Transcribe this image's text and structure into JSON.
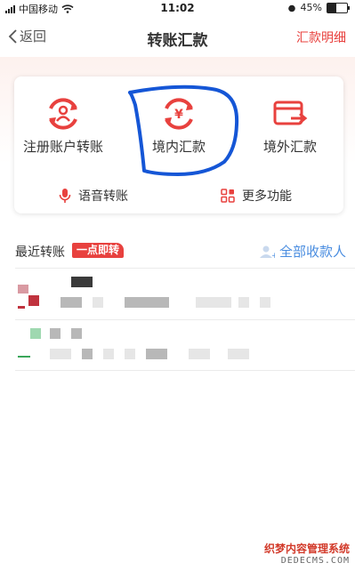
{
  "status_bar": {
    "carrier": "中国移动",
    "time": "11:02",
    "battery": "45%",
    "battery_level": 0.45
  },
  "nav": {
    "back_label": "返回",
    "title": "转账汇款",
    "right_link": "汇款明细"
  },
  "functions": [
    {
      "label": "注册账户转账",
      "icon": "account-transfer-icon"
    },
    {
      "label": "境内汇款",
      "icon": "yuan-remit-icon"
    },
    {
      "label": "境外汇款",
      "icon": "overseas-remit-icon"
    }
  ],
  "small_functions": [
    {
      "label": "语音转账",
      "icon": "microphone-icon"
    },
    {
      "label": "更多功能",
      "icon": "grid-apps-icon"
    }
  ],
  "recent": {
    "title": "最近转账",
    "badge": "一点即转",
    "all_payees": "全部收款人"
  },
  "colors": {
    "accent_red": "#e8413e",
    "link_blue": "#4a8de0",
    "annotation_blue": "#1556d6"
  },
  "watermark": {
    "line1": "织梦内容管理系统",
    "line2": "DEDECMS.COM"
  }
}
